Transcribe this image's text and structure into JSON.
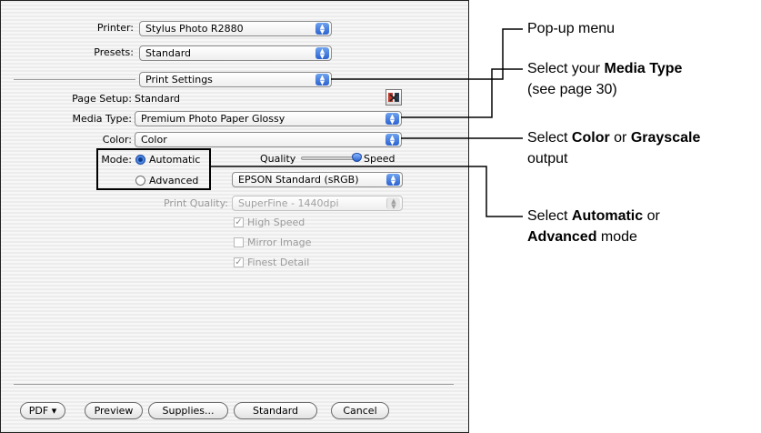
{
  "dialog": {
    "printer_label": "Printer:",
    "printer_value": "Stylus Photo R2880",
    "presets_label": "Presets:",
    "presets_value": "Standard",
    "section_value": "Print Settings",
    "page_setup_label": "Page Setup:",
    "page_setup_value": "Standard",
    "help_icon": "help-book-icon",
    "media_type_label": "Media Type:",
    "media_type_value": "Premium Photo Paper Glossy",
    "color_label": "Color:",
    "color_value": "Color",
    "mode_label": "Mode:",
    "mode_automatic": "Automatic",
    "mode_advanced": "Advanced",
    "mode_selected": "Automatic",
    "quality_label": "Quality",
    "speed_label": "Speed",
    "quality_slider_level": 1.0,
    "color_mode_value": "EPSON Standard (sRGB)",
    "print_quality_label": "Print Quality:",
    "print_quality_value": "SuperFine - 1440dpi",
    "high_speed": {
      "label": "High Speed",
      "checked": true
    },
    "mirror_image": {
      "label": "Mirror Image",
      "checked": false
    },
    "finest_detail": {
      "label": "Finest Detail",
      "checked": true
    },
    "buttons": {
      "pdf": "PDF ▾",
      "preview": "Preview",
      "supplies": "Supplies...",
      "standard": "Standard",
      "cancel": "Cancel"
    }
  },
  "callouts": {
    "popup_menu": "Pop-up menu",
    "media_1_pre": "Select your ",
    "media_1_bold": "Media Type",
    "media_2": "(see page 30)",
    "color_1_pre": "Select ",
    "color_1_bold1": "Color",
    "color_1_mid": " or ",
    "color_1_bold2": "Grayscale",
    "color_2": "output",
    "mode_1_pre": "Select ",
    "mode_1_bold": "Automatic",
    "mode_1_post": " or",
    "mode_2_bold": "Advanced",
    "mode_2_post": " mode"
  },
  "colors": {
    "accent": "#2c63cf"
  }
}
